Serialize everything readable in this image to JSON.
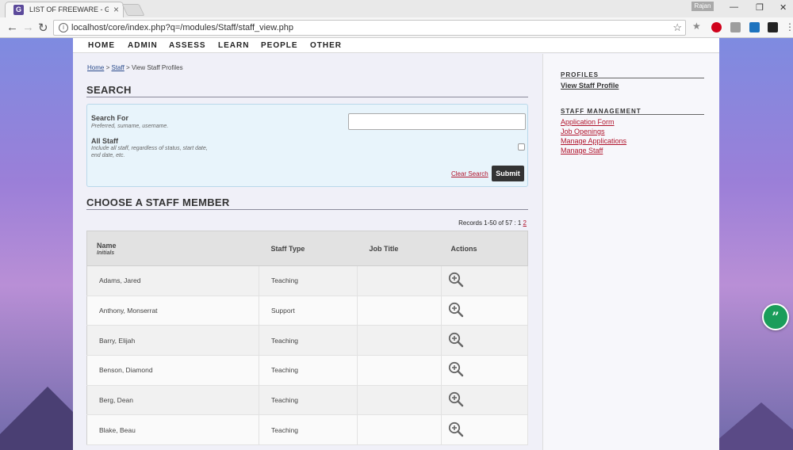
{
  "browser": {
    "tab_title": "LIST OF FREEWARE - Gib",
    "tab_favicon": "G",
    "user": "Rajan",
    "url": "localhost/core/index.php?q=/modules/Staff/staff_view.php"
  },
  "mainnav": [
    "HOME",
    "ADMIN",
    "ASSESS",
    "LEARN",
    "PEOPLE",
    "OTHER"
  ],
  "breadcrumb": {
    "home": "Home",
    "staff": "Staff",
    "current": "View Staff Profiles",
    "sep": ">"
  },
  "search": {
    "title": "SEARCH",
    "search_for_label": "Search For",
    "search_for_help": "Preferred, surname, username.",
    "all_staff_label": "All Staff",
    "all_staff_help": "Include all staff, regardless of status, start date, end date, etc.",
    "input_value": "",
    "clear_label": "Clear Search",
    "submit_label": "Submit"
  },
  "choose": {
    "title": "CHOOSE A STAFF MEMBER",
    "records_prefix": "Records 1-50 of 57 : 1",
    "page_2": "2"
  },
  "table": {
    "headers": {
      "name": "Name",
      "name_sub": "Initials",
      "type": "Staff Type",
      "job": "Job Title",
      "actions": "Actions"
    },
    "rows": [
      {
        "name": "Adams, Jared",
        "type": "Teaching",
        "job": ""
      },
      {
        "name": "Anthony, Monserrat",
        "type": "Support",
        "job": ""
      },
      {
        "name": "Barry, Elijah",
        "type": "Teaching",
        "job": ""
      },
      {
        "name": "Benson, Diamond",
        "type": "Teaching",
        "job": ""
      },
      {
        "name": "Berg, Dean",
        "type": "Teaching",
        "job": ""
      },
      {
        "name": "Blake, Beau",
        "type": "Teaching",
        "job": ""
      }
    ]
  },
  "sidebar": {
    "profiles_title": "PROFILES",
    "view_staff_profile": "View Staff Profile",
    "mgmt_title": "STAFF MANAGEMENT",
    "links": [
      "Application Form",
      "Job Openings",
      "Manage Applications",
      "Manage Staff"
    ]
  },
  "icons": {
    "zoom": "zoom-in-icon",
    "fab": "quote-icon"
  },
  "colors": {
    "accent_red": "#b0142c",
    "submit_bg": "#333333",
    "fab_green": "#1a9d5a"
  }
}
